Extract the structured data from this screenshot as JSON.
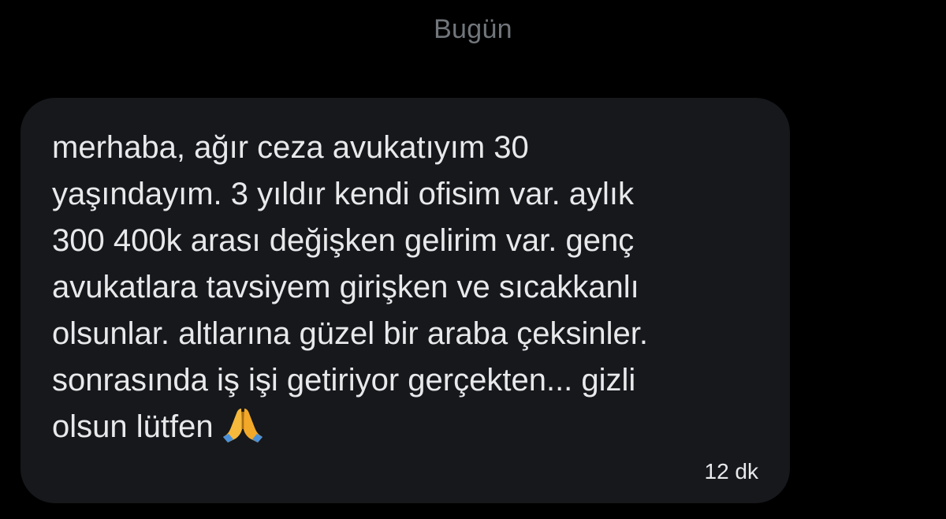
{
  "conversation": {
    "date_separator": "Bugün"
  },
  "message": {
    "text_lines": [
      "merhaba, ağır ceza avukatıyım 30",
      "yaşındayım. 3 yıldır kendi ofisim var. aylık",
      "300 400k arası değişken gelirim var. genç",
      "avukatlara tavsiyem girişken ve sıcakkanlı",
      "olsunlar. altlarına güzel bir araba çeksinler.",
      "sonrasında iş işi getiriyor gerçekten... gizli",
      "olsun lütfen"
    ],
    "emoji": "folded-hands-emoji",
    "timestamp": "12 dk"
  },
  "colors": {
    "background": "#000000",
    "bubble": "#16181c",
    "text": "#e7e9ea",
    "muted": "#71767b",
    "emoji_hands": "#f6b93b"
  }
}
